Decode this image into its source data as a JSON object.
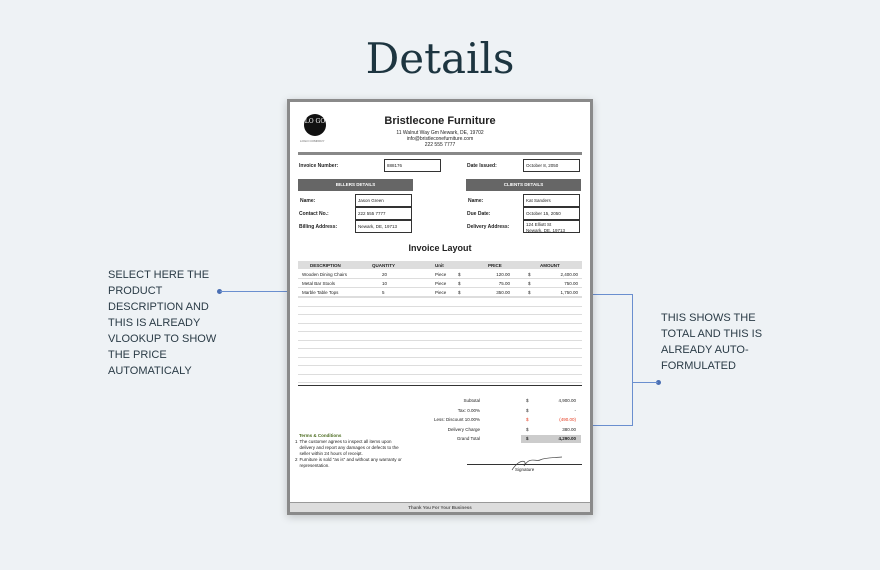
{
  "heading": "Details",
  "annotations": {
    "left": "Select here the product description  and this is already vlookup to show the price automaticaly",
    "right": "This shows the total and this is already auto-formulated"
  },
  "accent": "#4a6fb3",
  "invoice": {
    "logo": "LO GO",
    "logo_caption": "LOGO COMPANY",
    "company": "Bristlecone Furniture",
    "address": "11 Walnut Way Gm Newark, DE, 19702",
    "email": "info@bristleconefurniture.com",
    "phone": "222 555 7777",
    "invoice_number_label": "Invoice Number:",
    "invoice_number": "888176",
    "date_issued_label": "Date Issued:",
    "date_issued": "October 8, 2050",
    "billers_header": "BILLERS DETAILS",
    "clients_header": "CLIENTS DETAILS",
    "billers": {
      "name_label": "Name:",
      "name": "Jason Green",
      "contact_label": "Contact No.:",
      "contact": "222 555 7777",
      "address_label": "Billing Address:",
      "address": "Newark, DE, 19713"
    },
    "clients": {
      "name_label": "Name:",
      "name": "Kat Sanders",
      "due_label": "Due Date:",
      "due": "October 15, 2050",
      "address_label": "Delivery Address:",
      "address1": "124 Elliott St",
      "address2": "Newark, DE, 19713"
    },
    "layout_title": "Invoice Layout",
    "columns": [
      "DESCRIPTION",
      "QUANTITY",
      "Unit",
      "PRICE",
      "AMOUNT"
    ],
    "items": [
      {
        "desc": "Wooden Dining Chairs",
        "qty": "20",
        "unit": "Piece",
        "cur": "$",
        "price": "120.00",
        "cur2": "$",
        "amount": "2,400.00"
      },
      {
        "desc": "Metal Bar Stools",
        "qty": "10",
        "unit": "Piece",
        "cur": "$",
        "price": "75.00",
        "cur2": "$",
        "amount": "750.00"
      },
      {
        "desc": "Marble Table Tops",
        "qty": "5",
        "unit": "Piece",
        "cur": "$",
        "price": "350.00",
        "cur2": "$",
        "amount": "1,750.00"
      }
    ],
    "totals": [
      {
        "label": "Subtotal",
        "cur": "$",
        "value": "4,900.00"
      },
      {
        "label": "Tax: 0.00%",
        "cur": "$",
        "value": "-"
      },
      {
        "label": "Less: Discount 10.00%",
        "cur": "$",
        "value": "(490.00)"
      },
      {
        "label": "Delivery Charge",
        "cur": "$",
        "value": "380.00"
      },
      {
        "label": "Grand Total",
        "cur": "$",
        "value": "4,290.00"
      }
    ],
    "discount_color": "#e53a1f",
    "terms_title": "Terms & Conditions",
    "terms": [
      {
        "n": "1",
        "text": "The customer agrees to inspect all items upon delivery and report any damages or defects to the seller within 24 hours of receipt."
      },
      {
        "n": "2",
        "text": "Furniture is sold \"as is\" and without any warranty or representation."
      }
    ],
    "signature_label": "Signature",
    "footer": "Thank You For Your Business"
  }
}
